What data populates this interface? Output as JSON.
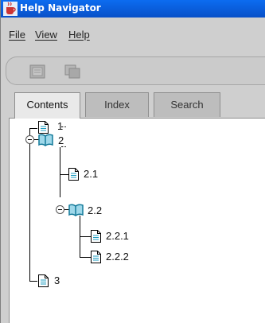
{
  "window": {
    "title": "Help Navigator"
  },
  "menubar": {
    "file": "File",
    "view": "View",
    "help": "Help"
  },
  "tabs": {
    "contents": "Contents",
    "index": "Index",
    "search": "Search",
    "active": "Contents"
  },
  "tree": {
    "n1": "1",
    "n2": "2",
    "n2_1": "2.1",
    "n2_2": "2.2",
    "n2_2_1": "2.2.1",
    "n2_2_2": "2.2.2",
    "n3": "3"
  },
  "icons": {
    "app": "java-cup-icon",
    "toolbar": [
      "back-icon",
      "print-icon"
    ],
    "topic": "document-icon",
    "folder": "open-book-icon",
    "expander": "collapse-toggle-icon"
  },
  "colors": {
    "titlebar": "#0a5ee0",
    "folder_icon": "#1e9cc0"
  }
}
